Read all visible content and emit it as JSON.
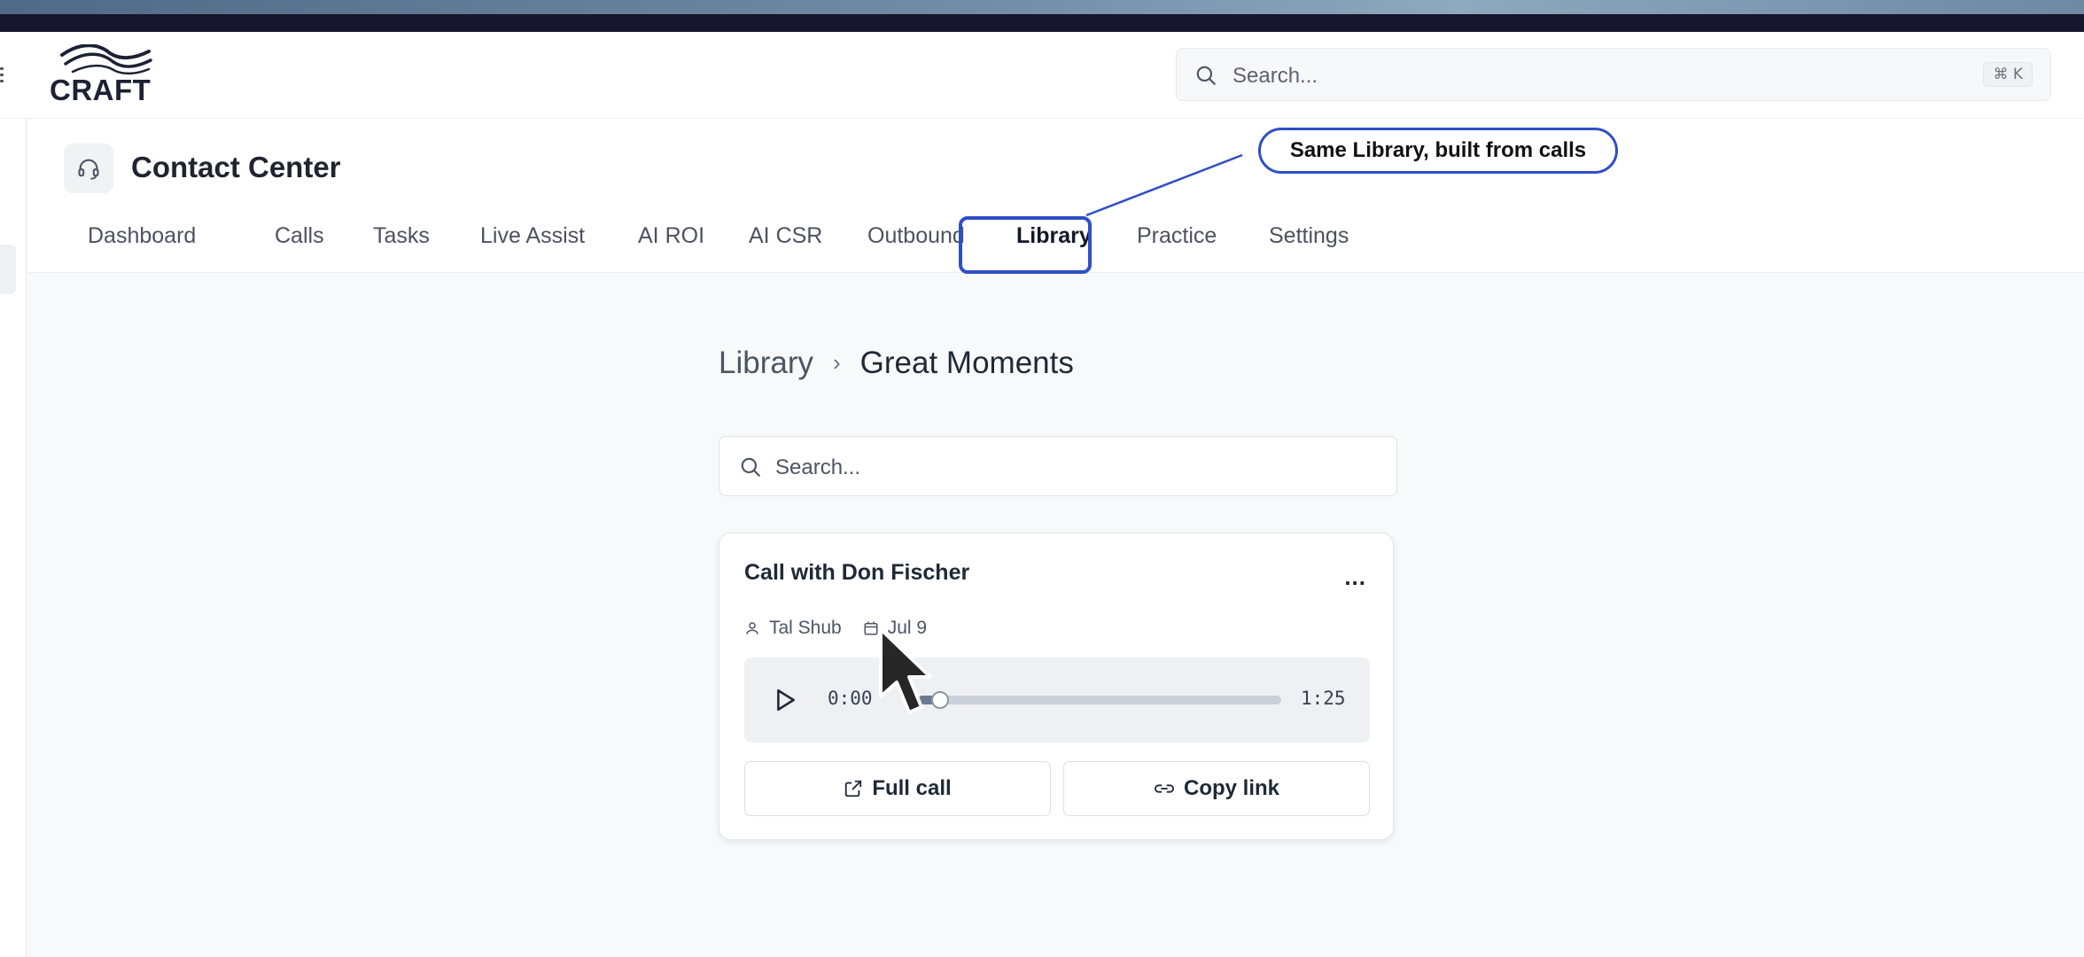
{
  "brand": {
    "logo_text": "CRAFT"
  },
  "top_search": {
    "placeholder": "Search...",
    "shortcut": "⌘ K"
  },
  "app": {
    "title": "Contact Center"
  },
  "tabs": [
    {
      "label": "Dashboard"
    },
    {
      "label": "Calls"
    },
    {
      "label": "Tasks"
    },
    {
      "label": "Live Assist"
    },
    {
      "label": "AI ROI"
    },
    {
      "label": "AI CSR"
    },
    {
      "label": "Outbound"
    },
    {
      "label": "Library",
      "active": true
    },
    {
      "label": "Practice"
    },
    {
      "label": "Settings"
    }
  ],
  "callout": {
    "text": "Same Library, built from calls",
    "color": "#2f4fc6"
  },
  "breadcrumb": {
    "root": "Library",
    "separator": "›",
    "current": "Great Moments"
  },
  "library_search": {
    "placeholder": "Search..."
  },
  "card": {
    "title": "Call with Don Fischer",
    "menu": "...",
    "agent": "Tal Shub",
    "date": "Jul 9",
    "player": {
      "current_time": "0:00",
      "total_time": "1:25",
      "progress": 0.06
    },
    "full_call_label": "Full call",
    "copy_link_label": "Copy link"
  },
  "icons": {
    "search": "search-icon",
    "headset": "headset-icon",
    "user": "user-icon",
    "calendar": "calendar-icon",
    "play": "play-icon",
    "external_link": "external-link-icon",
    "link": "link-icon"
  }
}
